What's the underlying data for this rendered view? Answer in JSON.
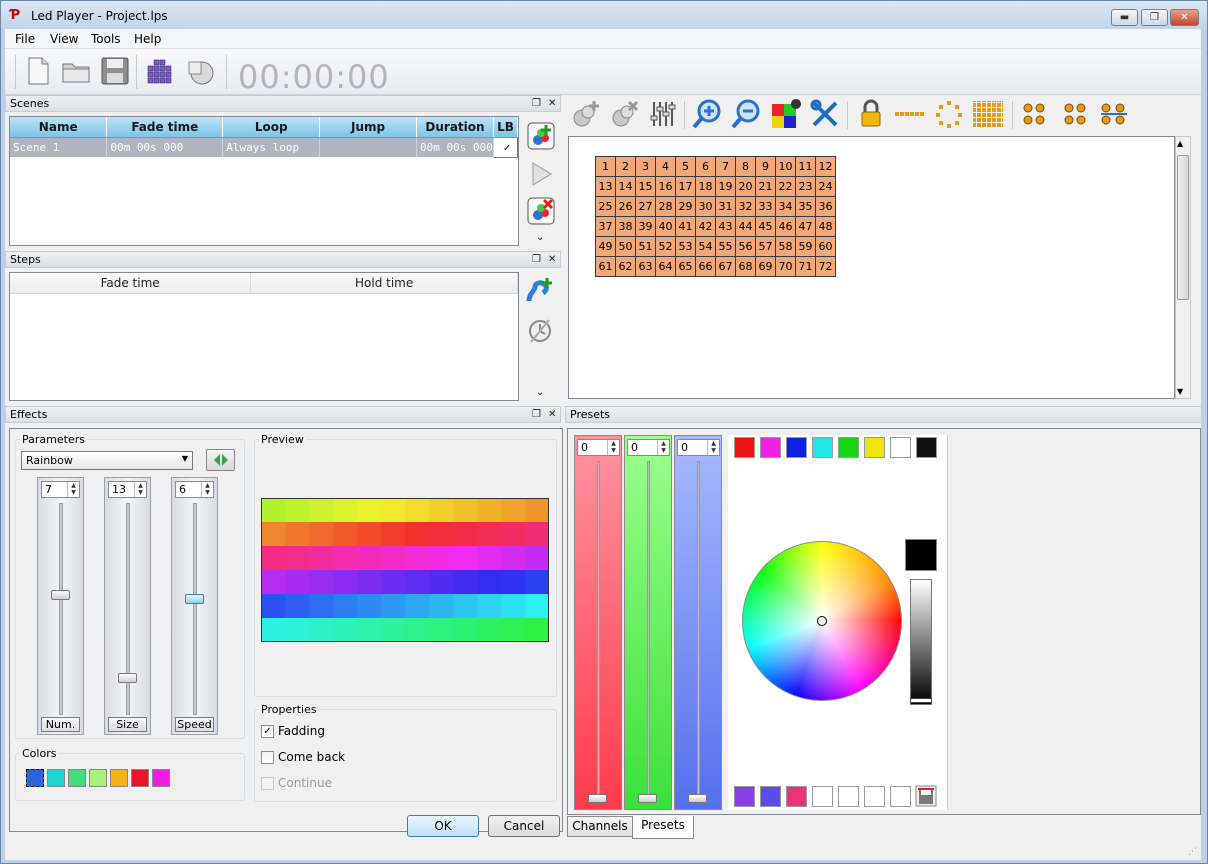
{
  "window": {
    "title": "Led Player - Project.lps",
    "minimize": "▬",
    "restore": "❐",
    "close": "✕"
  },
  "menu": [
    "File",
    "View",
    "Tools",
    "Help"
  ],
  "toolbar": {
    "timer": "00:00:00",
    "icons": [
      "new-file-icon",
      "open-folder-icon",
      "save-icon",
      "grid-matrix-icon",
      "disc-icon"
    ]
  },
  "scenes": {
    "header": "Scenes",
    "columns": [
      "Name",
      "Fade time",
      "Loop",
      "Jump",
      "Duration",
      "LB"
    ],
    "rows": [
      {
        "name": "Scene 1",
        "fade": "00m 00s 000",
        "loop": "Always loop",
        "jump": "",
        "duration": "00m 00s 000",
        "lb": "✓"
      }
    ]
  },
  "steps": {
    "header": "Steps",
    "columns": [
      "Fade time",
      "Hold time"
    ]
  },
  "effects": {
    "header": "Effects",
    "parameters_title": "Parameters",
    "effect_selected": "Rainbow",
    "sliders": [
      {
        "label": "Num.",
        "value": "7",
        "level": 0.58
      },
      {
        "label": "Size",
        "value": "13",
        "level": 0.18
      },
      {
        "label": "Speed",
        "value": "6",
        "level": 0.56
      }
    ],
    "preview_title": "Preview",
    "colors_title": "Colors",
    "colors": [
      "#2b63d9",
      "#21d3d3",
      "#3fe07a",
      "#a6f27a",
      "#f7b21b",
      "#e8162b",
      "#ee1ae6"
    ],
    "properties_title": "Properties",
    "properties": [
      {
        "label": "Fadding",
        "checked": true,
        "disabled": false
      },
      {
        "label": "Come back",
        "checked": false,
        "disabled": false
      },
      {
        "label": "Continue",
        "checked": false,
        "disabled": true
      }
    ]
  },
  "grid": {
    "rows": 6,
    "cols": 12
  },
  "presets": {
    "header": "Presets",
    "channels": [
      {
        "value": "0",
        "color": "#ff6d7a"
      },
      {
        "value": "0",
        "color": "#66ee5c"
      },
      {
        "value": "0",
        "color": "#6f8cf2"
      }
    ],
    "top_swatches": [
      "#ee1212",
      "#f21ee6",
      "#0d1fe0",
      "#22e6e6",
      "#12d812",
      "#f2e30e",
      "#ffffff",
      "#111111"
    ],
    "bottom_swatches": [
      "#8a3ee6",
      "#5c4be8",
      "#ea3378",
      "#ffffff",
      "#ffffff",
      "#ffffff",
      "#ffffff"
    ],
    "current_color": "#000000"
  },
  "buttons": {
    "ok": "OK",
    "cancel": "Cancel"
  },
  "tabs": [
    "Channels",
    "Presets"
  ]
}
